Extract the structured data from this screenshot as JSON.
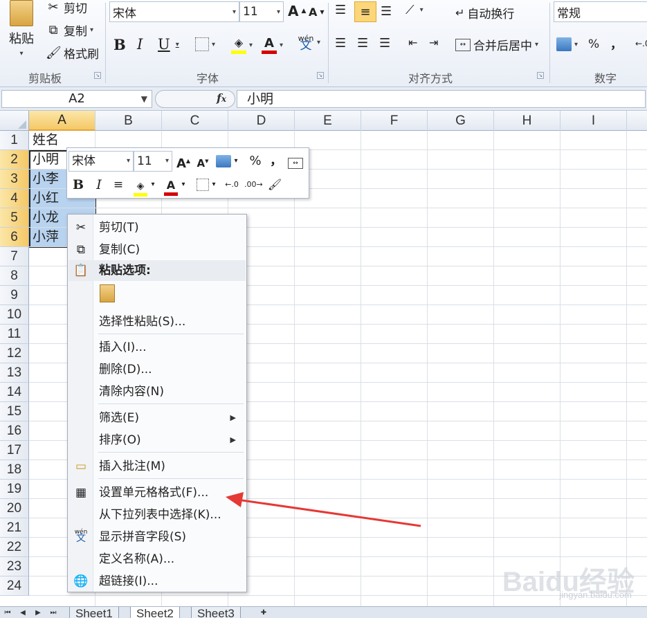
{
  "ribbon": {
    "clipboard": {
      "paste": "粘贴",
      "cut": "剪切",
      "copy": "复制",
      "format_painter": "格式刷",
      "group_label": "剪贴板"
    },
    "font": {
      "family": "宋体",
      "size": "11",
      "group_label": "字体",
      "font_color": "#d40000",
      "fill_color": "#ffff00"
    },
    "alignment": {
      "wrap": "自动换行",
      "merge": "合并后居中",
      "group_label": "对齐方式"
    },
    "number": {
      "format": "常规",
      "percent": "%",
      "comma": "，",
      "group_label": "数字"
    }
  },
  "formula_bar": {
    "name_box": "A2",
    "fx": "fx",
    "value": "小明"
  },
  "columns": [
    "A",
    "B",
    "C",
    "D",
    "E",
    "F",
    "G",
    "H",
    "I"
  ],
  "rows": [
    "1",
    "2",
    "3",
    "4",
    "5",
    "6",
    "7",
    "8",
    "9",
    "10",
    "11",
    "12",
    "13",
    "14",
    "15",
    "16",
    "17",
    "18",
    "19",
    "20",
    "21",
    "22",
    "23",
    "24"
  ],
  "cells": {
    "A1": "姓名",
    "A2": "小明",
    "A3": "小李",
    "A4": "小红",
    "A5": "小龙",
    "A6": "小萍"
  },
  "mini_toolbar": {
    "font": "宋体",
    "size": "11"
  },
  "context_menu": {
    "cut": "剪切(T)",
    "copy": "复制(C)",
    "paste_options": "粘贴选项:",
    "paste_special": "选择性粘贴(S)...",
    "insert": "插入(I)...",
    "delete": "删除(D)...",
    "clear": "清除内容(N)",
    "filter": "筛选(E)",
    "sort": "排序(O)",
    "insert_comment": "插入批注(M)",
    "format_cells": "设置单元格格式(F)...",
    "pick_list": "从下拉列表中选择(K)...",
    "phonetic": "显示拼音字段(S)",
    "define_name": "定义名称(A)...",
    "hyperlink": "超链接(I)..."
  },
  "sheet_tabs": [
    "Sheet1",
    "Sheet2",
    "Sheet3"
  ],
  "active_sheet": "Sheet2",
  "watermark": {
    "text": "Baidu经验",
    "url": "jingyan.baidu.com"
  },
  "colors": {
    "accent_selection": "#b8d3ef",
    "header_active": "#f5c867",
    "arrow": "#e53935"
  }
}
